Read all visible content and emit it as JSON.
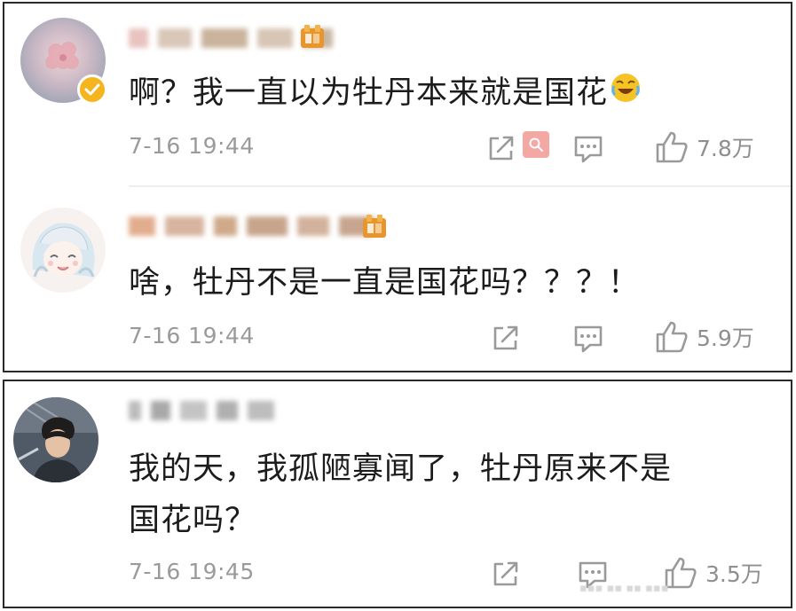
{
  "comments": [
    {
      "text": "啊？我一直以为牡丹本来就是国花",
      "emoji": "laughing-crying-emoji",
      "time": "7-16 19:44",
      "likes": "7.8万",
      "verified": true
    },
    {
      "text": "啥，牡丹不是一直是国花吗？？？！",
      "time": "7-16 19:44",
      "likes": "5.9万"
    },
    {
      "text_line1": "我的天，我孤陋寡闻了，牡丹原来不是",
      "text_line2": "国花吗？",
      "time": "7-16 19:45",
      "likes": "3.5万"
    }
  ],
  "icons": {
    "share": "share-icon",
    "reply": "comment-icon",
    "like": "thumbs-up-icon",
    "search": "search-icon",
    "level": "level-badge-icon"
  },
  "colors": {
    "verified": "#f5b51e",
    "meta_text": "#9a9a9a",
    "level_badge": "#e8952b",
    "search_tag": "#f3a8a4"
  }
}
